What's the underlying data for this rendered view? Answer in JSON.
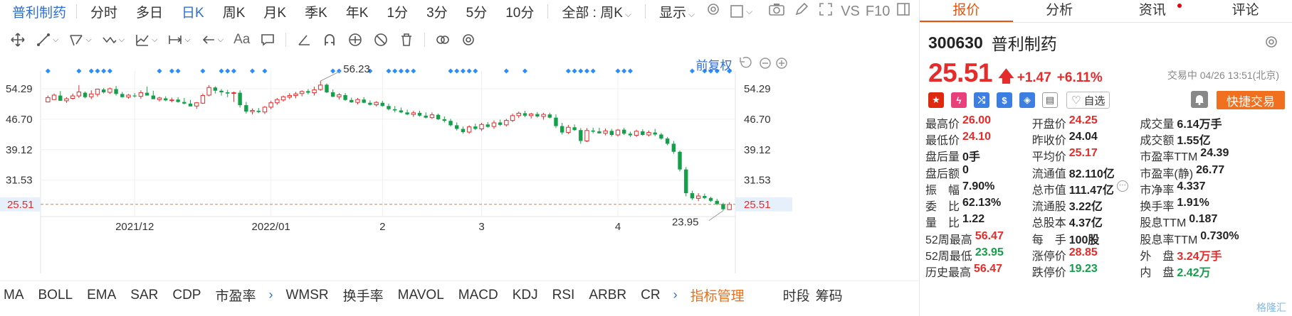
{
  "period_bar": {
    "stock_name": "普利制药",
    "items": [
      "分时",
      "多日",
      "日K",
      "周K",
      "月K",
      "季K",
      "年K",
      "1分",
      "3分",
      "5分",
      "10分"
    ],
    "active": "日K",
    "all_label": "全部 : 周K",
    "display_label": "显示",
    "vs_label": "VS",
    "f10_label": "F10"
  },
  "tool_bar": {
    "aa_label": "Aa"
  },
  "chart": {
    "rights_label": "前复权",
    "y_ticks": [
      "54.29",
      "46.70",
      "39.12",
      "31.53"
    ],
    "current_label": "25.51",
    "high_label": "56.23",
    "low_label": "23.95",
    "x_ticks": [
      "2021/12",
      "2022/01",
      "2",
      "3",
      "4"
    ]
  },
  "chart_data": {
    "type": "candlestick",
    "ylim": [
      23.0,
      58.0
    ],
    "y_ticks": [
      54.29,
      46.7,
      39.12,
      31.53
    ],
    "current_price": 25.51,
    "period_high": 56.23,
    "period_low": 23.95,
    "x_ticks": [
      "2021/12",
      "2022/01",
      "2",
      "3",
      "4"
    ],
    "candles": [
      [
        51.0,
        52.6,
        50.9,
        52.1
      ],
      [
        51.6,
        53.1,
        51.5,
        52.7
      ],
      [
        52.6,
        53.7,
        52.2,
        51.3
      ],
      [
        51.3,
        52.2,
        50.8,
        51.8
      ],
      [
        51.9,
        53.1,
        51.6,
        52.5
      ],
      [
        52.5,
        55.2,
        52.0,
        53.5
      ],
      [
        53.3,
        53.6,
        51.9,
        52.2
      ],
      [
        52.3,
        53.9,
        51.7,
        53.0
      ],
      [
        52.9,
        54.3,
        52.3,
        54.2
      ],
      [
        54.1,
        54.5,
        53.1,
        53.4
      ],
      [
        53.4,
        54.6,
        53.0,
        54.3
      ],
      [
        54.2,
        55.0,
        52.6,
        53.0
      ],
      [
        53.0,
        53.5,
        52.1,
        52.2
      ],
      [
        52.2,
        53.0,
        51.8,
        52.7
      ],
      [
        52.6,
        53.2,
        52.1,
        52.4
      ],
      [
        52.4,
        53.9,
        51.8,
        53.3
      ],
      [
        53.3,
        54.8,
        52.8,
        52.6
      ],
      [
        52.6,
        53.8,
        52.0,
        51.7
      ],
      [
        51.6,
        52.3,
        51.1,
        52.0
      ],
      [
        51.9,
        52.4,
        51.2,
        51.4
      ],
      [
        51.4,
        52.1,
        50.9,
        51.5
      ],
      [
        51.6,
        52.2,
        50.8,
        51.0
      ],
      [
        51.0,
        52.0,
        50.4,
        50.6
      ],
      [
        50.6,
        51.5,
        50.0,
        49.9
      ],
      [
        50.0,
        51.0,
        49.3,
        50.8
      ],
      [
        50.7,
        53.1,
        50.5,
        52.6
      ],
      [
        52.7,
        55.2,
        52.4,
        54.6
      ],
      [
        54.6,
        54.9,
        53.1,
        53.8
      ],
      [
        53.8,
        54.2,
        52.6,
        53.4
      ],
      [
        53.4,
        54.0,
        52.2,
        53.1
      ],
      [
        53.2,
        53.6,
        51.0,
        53.3
      ],
      [
        53.3,
        53.9,
        49.6,
        50.2
      ],
      [
        50.2,
        51.0,
        48.1,
        48.6
      ],
      [
        48.6,
        49.4,
        47.9,
        48.9
      ],
      [
        48.8,
        49.5,
        48.2,
        48.5
      ],
      [
        48.5,
        50.0,
        48.0,
        49.7
      ],
      [
        49.7,
        51.3,
        49.2,
        50.8
      ],
      [
        50.8,
        52.0,
        50.3,
        51.6
      ],
      [
        51.5,
        52.6,
        51.1,
        52.3
      ],
      [
        52.2,
        53.2,
        51.7,
        52.6
      ],
      [
        52.6,
        53.5,
        51.9,
        53.0
      ],
      [
        53.1,
        53.9,
        52.4,
        53.6
      ],
      [
        53.7,
        54.2,
        52.9,
        53.3
      ],
      [
        53.3,
        54.8,
        52.6,
        54.0
      ],
      [
        54.1,
        56.23,
        53.8,
        55.2
      ],
      [
        55.3,
        55.6,
        53.2,
        53.4
      ],
      [
        53.4,
        54.1,
        52.2,
        52.3
      ],
      [
        52.3,
        53.2,
        51.6,
        52.8
      ],
      [
        52.7,
        53.2,
        51.3,
        51.5
      ],
      [
        51.5,
        52.1,
        50.8,
        50.9
      ],
      [
        50.9,
        52.0,
        50.4,
        51.6
      ],
      [
        51.6,
        52.2,
        50.7,
        50.8
      ],
      [
        50.8,
        51.4,
        50.1,
        50.3
      ],
      [
        50.3,
        51.2,
        49.9,
        50.9
      ],
      [
        50.8,
        51.3,
        49.8,
        50.0
      ],
      [
        50.0,
        50.6,
        48.9,
        49.2
      ],
      [
        49.2,
        50.0,
        48.4,
        48.9
      ],
      [
        48.9,
        49.6,
        48.2,
        48.4
      ],
      [
        48.4,
        49.1,
        47.7,
        47.9
      ],
      [
        47.9,
        48.8,
        47.3,
        48.3
      ],
      [
        48.3,
        48.8,
        47.4,
        47.6
      ],
      [
        47.6,
        48.4,
        46.9,
        47.1
      ],
      [
        47.1,
        48.4,
        46.8,
        47.8
      ],
      [
        47.8,
        48.1,
        46.5,
        46.7
      ],
      [
        46.7,
        47.4,
        45.9,
        46.3
      ],
      [
        46.3,
        46.8,
        44.9,
        45.2
      ],
      [
        45.2,
        45.9,
        43.9,
        44.3
      ],
      [
        44.3,
        44.9,
        43.1,
        43.5
      ],
      [
        43.5,
        45.2,
        43.1,
        44.8
      ],
      [
        44.9,
        45.6,
        44.0,
        44.3
      ],
      [
        44.3,
        45.8,
        43.8,
        45.4
      ],
      [
        45.4,
        46.0,
        44.6,
        44.8
      ],
      [
        44.9,
        46.4,
        44.3,
        45.8
      ],
      [
        45.9,
        46.6,
        45.0,
        45.3
      ],
      [
        45.3,
        46.8,
        44.9,
        46.4
      ],
      [
        46.4,
        48.1,
        46.0,
        47.6
      ],
      [
        47.6,
        48.6,
        47.0,
        48.2
      ],
      [
        48.2,
        48.8,
        47.2,
        47.6
      ],
      [
        47.6,
        48.3,
        46.9,
        48.0
      ],
      [
        48.0,
        48.5,
        47.1,
        47.4
      ],
      [
        47.4,
        48.3,
        46.6,
        47.9
      ],
      [
        47.9,
        48.3,
        46.9,
        47.1
      ],
      [
        47.1,
        47.9,
        44.5,
        45.0
      ],
      [
        45.0,
        45.8,
        42.9,
        43.4
      ],
      [
        43.4,
        45.3,
        43.0,
        44.7
      ],
      [
        44.7,
        45.4,
        43.8,
        44.0
      ],
      [
        44.0,
        44.5,
        40.6,
        41.3
      ],
      [
        41.3,
        44.5,
        41.0,
        43.9
      ],
      [
        43.9,
        44.6,
        43.2,
        43.6
      ],
      [
        43.7,
        44.6,
        43.1,
        43.2
      ],
      [
        43.2,
        44.4,
        42.7,
        43.8
      ],
      [
        43.8,
        44.3,
        42.4,
        42.8
      ],
      [
        42.8,
        44.3,
        42.4,
        44.0
      ],
      [
        44.1,
        44.6,
        42.8,
        43.1
      ],
      [
        43.1,
        43.6,
        42.3,
        42.7
      ],
      [
        42.7,
        44.1,
        42.3,
        43.7
      ],
      [
        43.7,
        44.2,
        42.6,
        42.8
      ],
      [
        42.8,
        43.9,
        42.4,
        43.4
      ],
      [
        43.4,
        44.3,
        42.5,
        42.9
      ],
      [
        42.9,
        43.3,
        41.6,
        41.9
      ],
      [
        41.9,
        42.3,
        40.2,
        40.6
      ],
      [
        40.6,
        41.3,
        38.1,
        38.6
      ],
      [
        38.6,
        38.9,
        33.7,
        34.2
      ],
      [
        34.2,
        34.8,
        27.5,
        28.3
      ],
      [
        28.3,
        28.9,
        26.6,
        27.0
      ],
      [
        27.0,
        28.3,
        26.3,
        27.6
      ],
      [
        27.6,
        28.2,
        26.8,
        27.1
      ],
      [
        27.1,
        27.4,
        26.1,
        26.4
      ],
      [
        26.4,
        26.9,
        25.3,
        25.6
      ],
      [
        25.6,
        25.9,
        23.95,
        24.3
      ],
      [
        24.2,
        26.0,
        24.1,
        25.51
      ]
    ],
    "event_markers": 46
  },
  "indicators": {
    "items": [
      "MA",
      "BOLL",
      "EMA",
      "SAR",
      "CDP",
      "市盈率",
      "WMSR",
      "换手率",
      "MAVOL",
      "MACD",
      "KDJ",
      "RSI",
      "ARBR",
      "CR"
    ],
    "manager": "指标管理",
    "right_items": [
      "时段",
      "筹码"
    ]
  },
  "right": {
    "tabs": [
      "报价",
      "分析",
      "资讯",
      "评论"
    ],
    "active_tab": "报价",
    "code": "300630",
    "name": "普利制药",
    "price": "25.51",
    "change": "+1.47",
    "change_pct": "+6.11%",
    "status": "交易中 04/26 13:51(北京)",
    "watch_label": "自选",
    "quick_trade": "快捷交易",
    "rows": [
      [
        [
          "最高价",
          "26.00",
          "red"
        ],
        [
          "开盘价",
          "24.25",
          "red"
        ],
        [
          "成交量",
          "6.14万手",
          ""
        ]
      ],
      [
        [
          "最低价",
          "24.10",
          "red"
        ],
        [
          "昨收价",
          "24.04",
          ""
        ],
        [
          "成交额",
          "1.55亿",
          ""
        ]
      ],
      [
        [
          "盘后量",
          "0手",
          ""
        ],
        [
          "平均价",
          "25.17",
          "red"
        ],
        [
          "市盈率TTM",
          "24.39",
          ""
        ]
      ],
      [
        [
          "盘后额",
          "0",
          ""
        ],
        [
          "流通值",
          "82.110亿",
          ""
        ],
        [
          "市盈率(静)",
          "26.77",
          ""
        ]
      ],
      [
        [
          "振　幅",
          "7.90%",
          ""
        ],
        [
          "总市值",
          "111.47亿",
          ""
        ],
        [
          "市净率",
          "4.337",
          ""
        ]
      ],
      [
        [
          "委　比",
          "62.13%",
          ""
        ],
        [
          "流通股",
          "3.22亿",
          ""
        ],
        [
          "换手率",
          "1.91%",
          ""
        ]
      ],
      [
        [
          "量　比",
          "1.22",
          ""
        ],
        [
          "总股本",
          "4.37亿",
          ""
        ],
        [
          "股息TTM",
          "0.187",
          ""
        ]
      ],
      [
        [
          "52周最高",
          "56.47",
          "red"
        ],
        [
          "每　手",
          "100股",
          ""
        ],
        [
          "股息率TTM",
          "0.730%",
          ""
        ]
      ],
      [
        [
          "52周最低",
          "23.95",
          "green"
        ],
        [
          "涨停价",
          "28.85",
          "red"
        ],
        [
          "外　盘",
          "3.24万手",
          "red"
        ]
      ],
      [
        [
          "历史最高",
          "56.47",
          "red"
        ],
        [
          "跌停价",
          "19.23",
          "green"
        ],
        [
          "内　盘",
          "2.42万",
          "green"
        ]
      ]
    ],
    "watermark": "格隆汇"
  },
  "colors": {
    "up": "#e62b2b",
    "down": "#14a04a",
    "accent": "#e8530e",
    "link": "#2f6fd0",
    "marker": "#2a8cff"
  }
}
